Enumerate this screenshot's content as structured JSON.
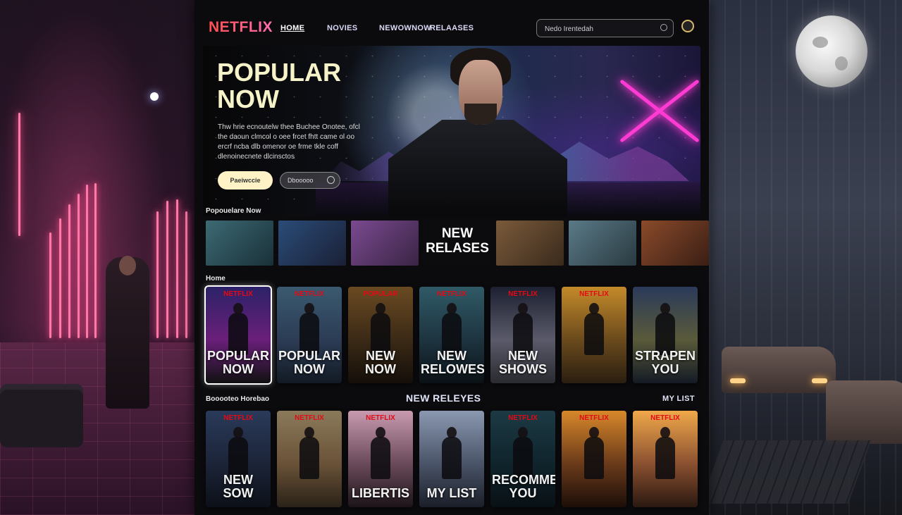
{
  "nav": {
    "logo": "NETFLIX",
    "items": [
      "HOME",
      "NOVIES",
      "NEWOWNOW",
      "RELAASES"
    ],
    "active_index": 0,
    "search_placeholder": "Nedo Irentedah"
  },
  "hero": {
    "title_line1": "POPULAR",
    "title_line2": "NOW",
    "description": "Thw hrie ecnoutelw thee Buchee Onotee, ofcl the daoun clmcol o oee frcet fhtt came ol oo ercrf ncba dlb omenor oe frme tkle coff dlenoinecnete dlcinsctos",
    "primary_button": "Paeiwccie",
    "secondary_button": "Dbooooo"
  },
  "row1": {
    "label": "Popouelare Now",
    "thumbs": [
      {
        "text": ""
      },
      {
        "text": ""
      },
      {
        "text": ""
      },
      {
        "text": "NEW RELASES"
      },
      {
        "text": ""
      },
      {
        "text": ""
      },
      {
        "text": ""
      }
    ]
  },
  "row2": {
    "label": "Home",
    "posters": [
      {
        "brand": "NETFLIX",
        "title": "POPULAR NOW",
        "selected": true,
        "colors": [
          "#2c2268",
          "#6a1f7a",
          "#111"
        ]
      },
      {
        "brand": "NETFLIX",
        "title": "POPULAR NOW",
        "selected": false,
        "colors": [
          "#3a5a70",
          "#2c3c55",
          "#121a24"
        ]
      },
      {
        "brand": "POPULAR",
        "title": "NEW NOW",
        "selected": false,
        "colors": [
          "#6a4a22",
          "#3b2a16",
          "#140e09"
        ]
      },
      {
        "brand": "NETFLIX",
        "title": "NEW RELOWES",
        "selected": false,
        "colors": [
          "#2f5a66",
          "#1d3440",
          "#0b1216"
        ]
      },
      {
        "brand": "NETFLIX",
        "title": "NEW SHOWS",
        "selected": false,
        "colors": [
          "#1c2030",
          "#5a5a6a",
          "#2a2a30"
        ]
      },
      {
        "brand": "NETFLIX",
        "title": "",
        "selected": false,
        "colors": [
          "#c48a2a",
          "#6a4a1c",
          "#2a1e10"
        ]
      },
      {
        "brand": "",
        "title": "STRAPEN YOU",
        "selected": false,
        "colors": [
          "#2a3a5a",
          "#5a5a3a",
          "#141a24"
        ]
      }
    ]
  },
  "row3": {
    "left_label": "Booooteo Horebao",
    "center_title": "NEW RELEYES",
    "right_label": "MY LIST",
    "posters": [
      {
        "brand": "NETFLIX",
        "title": "NEW SOW",
        "colors": [
          "#2a3a5a",
          "#1c2438",
          "#0c1018"
        ]
      },
      {
        "brand": "NETFLIX",
        "title": "",
        "colors": [
          "#8a7a5a",
          "#6a5238",
          "#2a2218"
        ]
      },
      {
        "brand": "NETFLIX",
        "title": "LIBERTIS",
        "colors": [
          "#c89ab0",
          "#6a4a5a",
          "#1c1418"
        ]
      },
      {
        "brand": "",
        "title": "MY LIST",
        "colors": [
          "#8a98b0",
          "#4a5468",
          "#1a1e28"
        ]
      },
      {
        "brand": "NETFLIX",
        "title": "RECOMMENDED YOU",
        "colors": [
          "#1c3a44",
          "#10242c",
          "#081014"
        ]
      },
      {
        "brand": "NETFLIX",
        "title": "",
        "colors": [
          "#d8882a",
          "#6a3a1a",
          "#1c0e08"
        ]
      },
      {
        "brand": "NETFLIX",
        "title": "",
        "colors": [
          "#f0a84a",
          "#8a5030",
          "#2a1810"
        ]
      }
    ]
  },
  "thumb_colors": [
    [
      "#3c6a74",
      "#1a3038"
    ],
    [
      "#2a4c78",
      "#1a2036"
    ],
    [
      "#7a4a90",
      "#3a2444"
    ],
    [
      "#0c0c0e",
      "#0c0c0e"
    ],
    [
      "#7a5a3a",
      "#3a2a1c"
    ],
    [
      "#5a7a88",
      "#2a3a40"
    ],
    [
      "#8a4a2a",
      "#3a1e14"
    ]
  ]
}
